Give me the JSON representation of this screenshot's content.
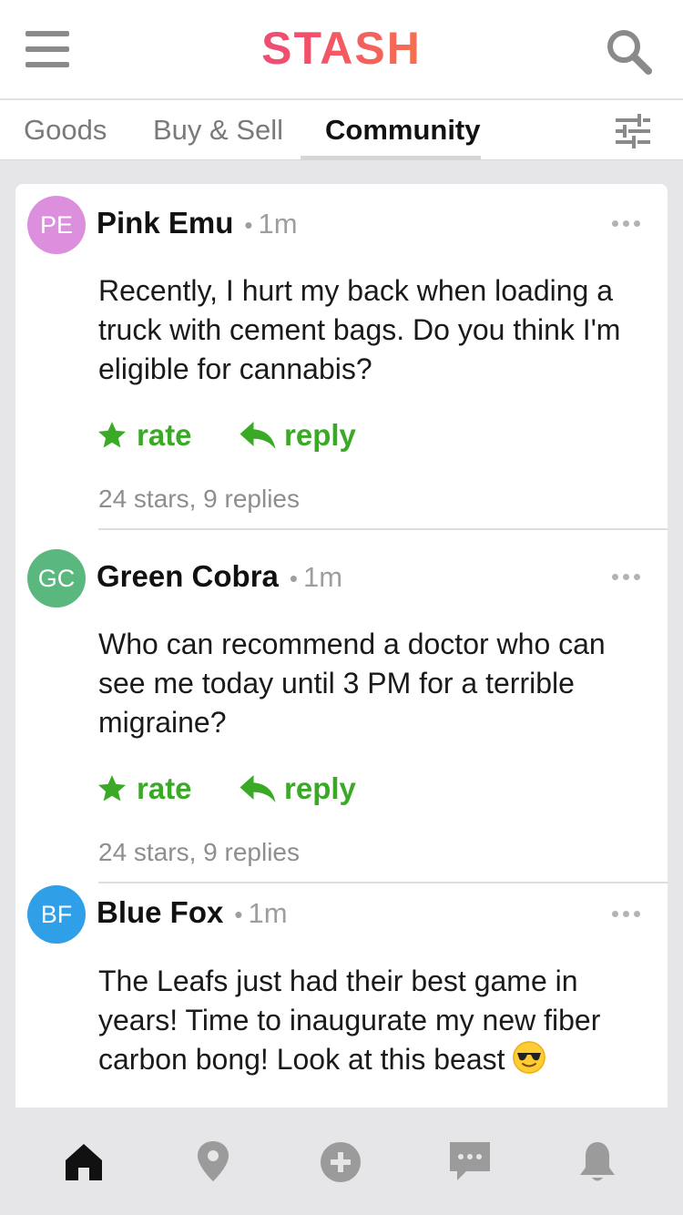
{
  "header": {
    "logo_text": "STASH",
    "menu_icon": "hamburger-menu-icon",
    "search_icon": "search-icon"
  },
  "tabs": [
    {
      "label": "Goods",
      "active": false
    },
    {
      "label": "Buy & Sell",
      "active": false
    },
    {
      "label": "Community",
      "active": true
    }
  ],
  "filter_icon": "sliders-filter-icon",
  "actions": {
    "rate_label": "rate",
    "reply_label": "reply"
  },
  "posts": [
    {
      "initials": "PE",
      "avatar_color": "#dc8fdc",
      "author": "Pink Emu",
      "time": "1m",
      "text": "Recently, I hurt my back when loading a truck with cement bags. Do you think I'm eligible for cannabis?",
      "stats": "24 stars, 9 replies"
    },
    {
      "initials": "GC",
      "avatar_color": "#5ab77d",
      "author": "Green Cobra",
      "time": "1m",
      "text": "Who can recommend a doctor who can see me today until 3 PM for a terrible migraine?",
      "stats": "24 stars, 9 replies"
    },
    {
      "initials": "BF",
      "avatar_color": "#2f9fe8",
      "author": "Blue Fox",
      "time": "1m",
      "text": "The Leafs just had their best game in years! Time to inaugurate my new fiber carbon bong! Look at this beast",
      "emoji": "sunglasses-emoji"
    }
  ],
  "bottom_nav": [
    {
      "icon": "home-icon",
      "active": true
    },
    {
      "icon": "location-pin-icon",
      "active": false
    },
    {
      "icon": "add-circle-icon",
      "active": false
    },
    {
      "icon": "chat-bubble-icon",
      "active": false
    },
    {
      "icon": "bell-icon",
      "active": false
    }
  ],
  "colors": {
    "accent_green": "#3aaa26",
    "active_nav": "#111111",
    "inactive_nav": "#9b9b9b"
  }
}
